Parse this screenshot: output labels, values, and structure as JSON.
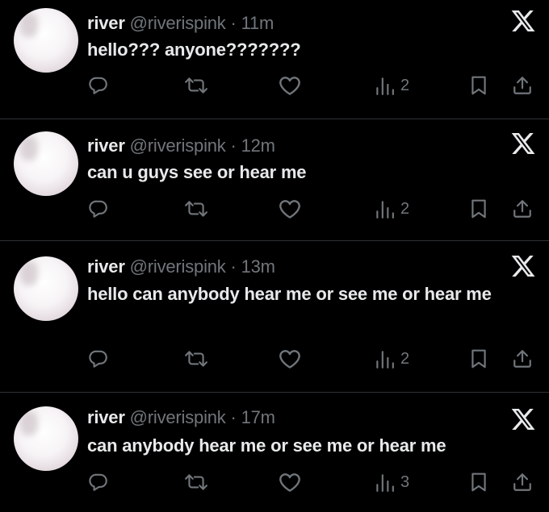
{
  "tweets": [
    {
      "name": "river",
      "handle": "@riverispink",
      "dot": "·",
      "time": "11m",
      "text": "hello??? anyone???????",
      "views": "2"
    },
    {
      "name": "river",
      "handle": "@riverispink",
      "dot": "·",
      "time": "12m",
      "text": "can u guys see or hear me",
      "views": "2"
    },
    {
      "name": "river",
      "handle": "@riverispink",
      "dot": "·",
      "time": "13m",
      "text": "hello can anybody hear me or see me or hear me",
      "views": "2"
    },
    {
      "name": "river",
      "handle": "@riverispink",
      "dot": "·",
      "time": "17m",
      "text": "can anybody hear me or see me or hear me",
      "views": "3"
    }
  ],
  "icons": {
    "close": "x-logo-icon",
    "reply": "reply-icon",
    "retweet": "retweet-icon",
    "like": "heart-icon",
    "views": "views-bar-chart-icon",
    "bookmark": "bookmark-icon",
    "share": "share-icon"
  },
  "colors": {
    "background": "#000000",
    "text": "#e7e9ea",
    "muted": "#71767b",
    "separator": "#2f3336"
  }
}
